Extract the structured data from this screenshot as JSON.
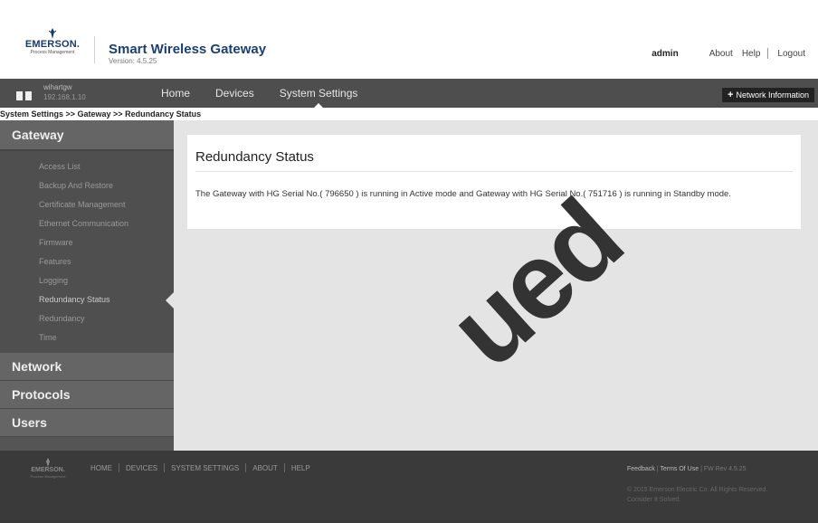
{
  "header": {
    "logo_text": "EMERSON.",
    "logo_sub": "Process Management",
    "app_title": "Smart Wireless Gateway",
    "version": "Version: 4.5.25",
    "user": "admin",
    "links": [
      "About",
      "Help",
      "Logout"
    ]
  },
  "navbar": {
    "gateway_name": "wihartgw",
    "gateway_ip": "192.168.1.10",
    "items": [
      "Home",
      "Devices",
      "System Settings"
    ],
    "active_item": "System Settings",
    "network_button": "Network Information"
  },
  "breadcrumb": "System Settings >> Gateway >> Redundancy Status",
  "sidebar": {
    "sections": [
      "Gateway",
      "Network",
      "Protocols",
      "Users"
    ],
    "gateway_items": [
      "Access List",
      "Backup And Restore",
      "Certificate Management",
      "Ethernet Communication",
      "Firmware",
      "Features",
      "Logging",
      "Redundancy Status",
      "Redundancy",
      "Time"
    ],
    "active_item": "Redundancy Status"
  },
  "main": {
    "title": "Redundancy Status",
    "message": "The Gateway with HG Serial No.( 796650 ) is running in Active mode and Gateway with HG Serial No.( 751716 ) is running in Standby mode."
  },
  "footer": {
    "logo_text": "EMERSON.",
    "logo_sub": "Process Management",
    "links": [
      "HOME",
      "DEVICES",
      "SYSTEM SETTINGS",
      "ABOUT",
      "HELP"
    ],
    "feedback": "Feedback",
    "terms": "Terms Of Use",
    "fw_rev": "FW Rev 4.5.25",
    "copyright": "© 2015 Emerson Electric Co. All Rights Reserved.",
    "consider": "Consider It Solved."
  },
  "watermark": "ued",
  "colors": {
    "navbar": "#4e4e4e",
    "sidebar": "#555555",
    "content_bg": "#e4e4e4",
    "footer": "#3a3a3a",
    "brand_blue": "#1c3f74"
  }
}
